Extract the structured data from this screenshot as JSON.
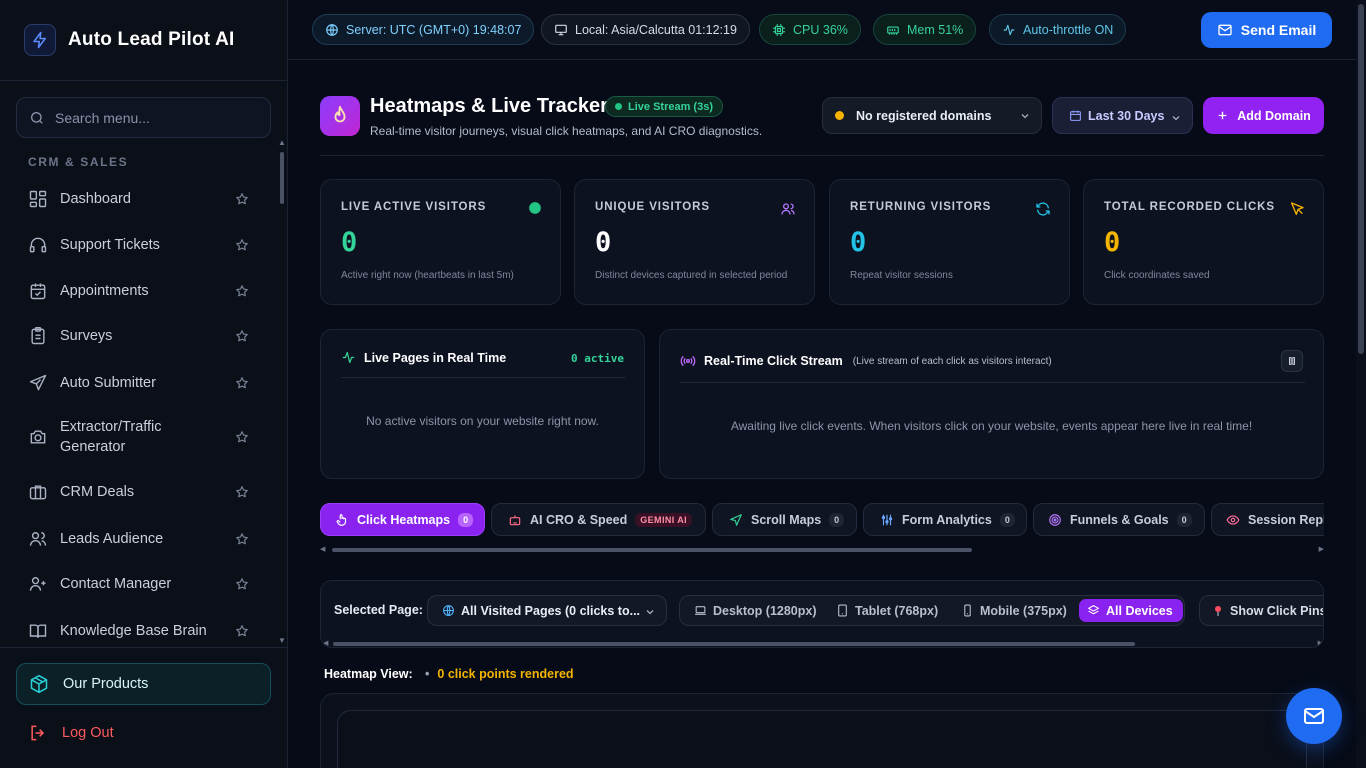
{
  "brand": {
    "name": "Auto Lead Pilot AI"
  },
  "sidebar": {
    "search_placeholder": "Search menu...",
    "section": "CRM & SALES",
    "items": [
      {
        "label": "Dashboard",
        "icon": "dashboard-icon"
      },
      {
        "label": "Support Tickets",
        "icon": "headset-icon"
      },
      {
        "label": "Appointments",
        "icon": "calendar-icon"
      },
      {
        "label": "Surveys",
        "icon": "clipboard-icon"
      },
      {
        "label": "Auto Submitter",
        "icon": "send-icon"
      },
      {
        "label": "Extractor/Traffic Generator",
        "icon": "camera-icon"
      },
      {
        "label": "CRM Deals",
        "icon": "briefcase-icon"
      },
      {
        "label": "Leads Audience",
        "icon": "users-icon"
      },
      {
        "label": "Contact Manager",
        "icon": "contacts-icon"
      },
      {
        "label": "Knowledge Base Brain",
        "icon": "book-icon"
      }
    ],
    "products_label": "Our Products",
    "logout_label": "Log Out"
  },
  "topbar": {
    "server": "Server: UTC (GMT+0) 19:48:07",
    "local": "Local: Asia/Calcutta 01:12:19",
    "cpu": "CPU 36%",
    "mem": "Mem 51%",
    "throttle": "Auto-throttle ON",
    "send_email": "Send Email"
  },
  "header": {
    "title": "Heatmaps & Live Tracker",
    "live_badge": "Live Stream (3s)",
    "subtitle": "Real-time visitor journeys, visual click heatmaps, and AI CRO diagnostics.",
    "domain_select": "No registered domains",
    "date_range": "Last 30 Days",
    "add_domain": "Add Domain"
  },
  "stats": [
    {
      "label": "LIVE ACTIVE VISITORS",
      "value": "0",
      "note": "Active right now (heartbeats in last 5m)",
      "color": "#34d39a"
    },
    {
      "label": "UNIQUE VISITORS",
      "value": "0",
      "note": "Distinct devices captured in selected period",
      "color": "#ffffff"
    },
    {
      "label": "RETURNING VISITORS",
      "value": "0",
      "note": "Repeat visitor sessions",
      "color": "#22c3e6"
    },
    {
      "label": "TOTAL RECORDED CLICKS",
      "value": "0",
      "note": "Click coordinates saved",
      "color": "#f5b400"
    }
  ],
  "live_pages": {
    "title": "Live Pages in Real Time",
    "count": "0 active",
    "empty": "No active visitors on your website right now."
  },
  "click_stream": {
    "title": "Real-Time Click Stream",
    "hint": "(Live stream of each click as visitors interact)",
    "empty": "Awaiting live click events. When visitors click on your website, events appear here live in real time!"
  },
  "tabs": [
    {
      "label": "Click Heatmaps",
      "badge": "0",
      "active": true
    },
    {
      "label": "AI CRO & Speed",
      "badge": "GEMINI AI"
    },
    {
      "label": "Scroll Maps",
      "badge": "0"
    },
    {
      "label": "Form Analytics",
      "badge": "0"
    },
    {
      "label": "Funnels & Goals",
      "badge": "0"
    },
    {
      "label": "Session Repl",
      "badge": ""
    }
  ],
  "filters": {
    "selected_page_label": "Selected Page:",
    "page_value": "All Visited Pages (0 clicks to...",
    "devices": [
      "Desktop (1280px)",
      "Tablet (768px)",
      "Mobile (375px)",
      "All Devices"
    ],
    "active_device": "All Devices",
    "pins": "Show Click Pins"
  },
  "heatmap": {
    "label": "Heatmap View:",
    "count": "0 click points rendered"
  }
}
